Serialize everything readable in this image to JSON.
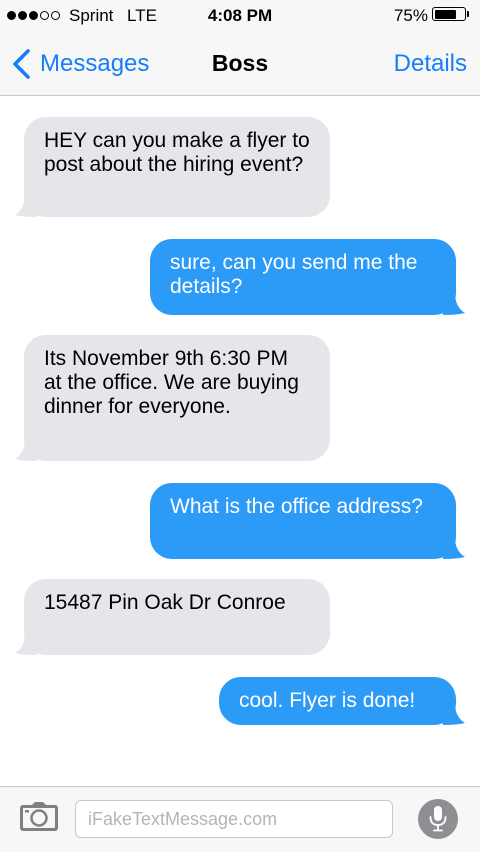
{
  "status_bar": {
    "signal_bars_filled": 3,
    "signal_bars_total": 5,
    "carrier": "Sprint",
    "network": "LTE",
    "time": "4:08 PM",
    "battery_percent_label": "75%",
    "battery_level": 0.75
  },
  "nav": {
    "back_label": "Messages",
    "title": "Boss",
    "details_label": "Details"
  },
  "messages": [
    {
      "direction": "received",
      "text": "HEY can you make a flyer to post about the hiring event?"
    },
    {
      "direction": "sent",
      "text": "sure, can you send me the details?"
    },
    {
      "direction": "received",
      "text": "Its November 9th 6:30 PM at the office. We are buying dinner for everyone."
    },
    {
      "direction": "sent",
      "text": "What is the office address?"
    },
    {
      "direction": "received",
      "text": "15487 Pin Oak Dr Conroe"
    },
    {
      "direction": "sent",
      "text": "cool. Flyer is done!"
    }
  ],
  "input_bar": {
    "placeholder": "iFakeTextMessage.com",
    "value": ""
  },
  "colors": {
    "accent": "#147efb",
    "sent_bubble": "#2c9af7",
    "received_bubble": "#e5e5ea",
    "bar_background": "#f7f7f7"
  },
  "icons": {
    "back": "chevron-left-icon",
    "camera": "camera-icon",
    "mic": "microphone-icon"
  }
}
